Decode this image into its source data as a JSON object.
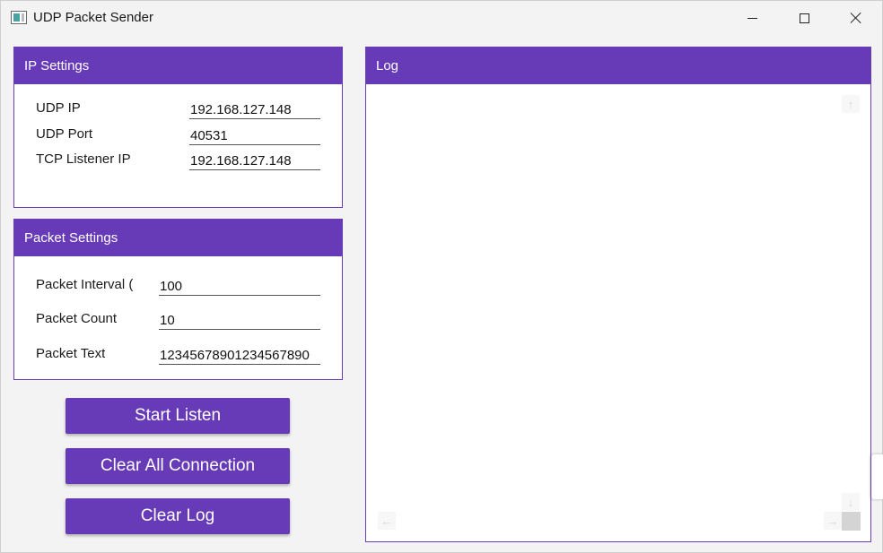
{
  "window": {
    "title": "UDP Packet Sender"
  },
  "ip_settings": {
    "header": "IP Settings",
    "fields": [
      {
        "label": "UDP IP",
        "value": "192.168.127.148"
      },
      {
        "label": "UDP Port",
        "value": "40531"
      },
      {
        "label": "TCP Listener IP",
        "value": "192.168.127.148"
      }
    ]
  },
  "packet_settings": {
    "header": "Packet Settings",
    "fields": [
      {
        "label": "Packet Interval (",
        "value": "100"
      },
      {
        "label": "Packet Count",
        "value": "10"
      },
      {
        "label": "Packet Text",
        "value": "12345678901234567890"
      }
    ]
  },
  "buttons": {
    "start_listen": "Start Listen",
    "clear_all_connection": "Clear All Connection",
    "clear_log": "Clear Log"
  },
  "log": {
    "header": "Log",
    "content": ""
  },
  "colors": {
    "accent": "#673ab7",
    "background": "#f3f3f3"
  },
  "icons": {
    "app": "app-window-icon",
    "minimize": "minimize-icon",
    "maximize": "maximize-icon",
    "close": "close-icon"
  }
}
